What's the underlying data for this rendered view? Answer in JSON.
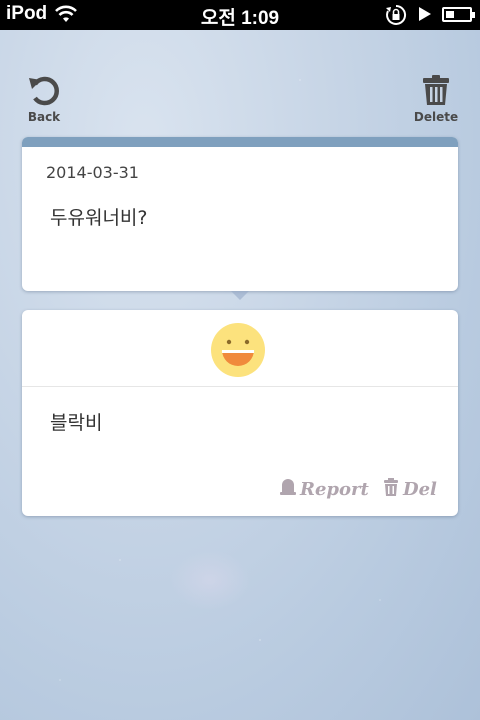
{
  "status_bar": {
    "carrier": "iPod",
    "time": "오전 1:09",
    "battery_level": 0.35
  },
  "nav": {
    "back_label": "Back",
    "delete_label": "Delete"
  },
  "question_card": {
    "date": "2014-03-31",
    "text": "두유워너비?"
  },
  "answer_card": {
    "emoji": "smiley-face",
    "text": "블락비",
    "report_label": "Report",
    "del_label": "Del"
  },
  "colors": {
    "card_header": "#7fa0be",
    "action_text": "#b0a5ae",
    "emoji_face": "#fce27d"
  }
}
